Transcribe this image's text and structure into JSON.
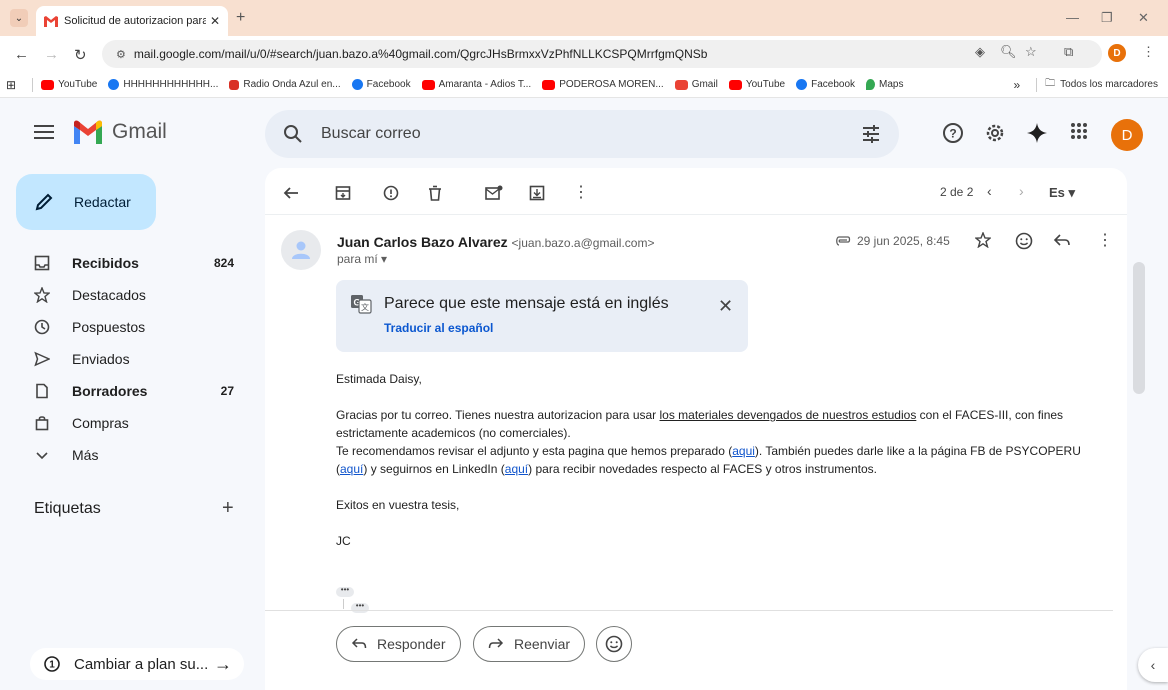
{
  "browser": {
    "tab_title": "Solicitud de autorizacion para e",
    "url": "mail.google.com/mail/u/0/#search/juan.bazo.a%40gmail.com/QgrcJHsBrmxxVzPhfNLLKCSPQMrrfgmQNSb",
    "profile_initial": "D",
    "bookmarks": [
      {
        "label": "YouTube",
        "color": "#ff0000"
      },
      {
        "label": "HHHHHHHHHHHH...",
        "color": "#1877f2"
      },
      {
        "label": "Radio Onda Azul en...",
        "color": "#d93025"
      },
      {
        "label": "Facebook",
        "color": "#1877f2"
      },
      {
        "label": "Amaranta - Adios T...",
        "color": "#ff0000"
      },
      {
        "label": "PODEROSA MOREN...",
        "color": "#ff0000"
      },
      {
        "label": "Gmail",
        "color": "#ea4335"
      },
      {
        "label": "YouTube",
        "color": "#ff0000"
      },
      {
        "label": "Facebook",
        "color": "#1877f2"
      },
      {
        "label": "Maps",
        "color": "#34a853"
      }
    ],
    "more_bookmarks": "»",
    "all_bookmarks": "Todos los marcadores"
  },
  "gmail": {
    "logo_text": "Gmail",
    "search_placeholder": "Buscar correo",
    "avatar_initial": "D",
    "compose_label": "Redactar",
    "nav": [
      {
        "label": "Recibidos",
        "count": "824",
        "bold": true
      },
      {
        "label": "Destacados",
        "count": "",
        "bold": false
      },
      {
        "label": "Pospuestos",
        "count": "",
        "bold": false
      },
      {
        "label": "Enviados",
        "count": "",
        "bold": false
      },
      {
        "label": "Borradores",
        "count": "27",
        "bold": true
      },
      {
        "label": "Compras",
        "count": "",
        "bold": false
      },
      {
        "label": "Más",
        "count": "",
        "bold": false
      }
    ],
    "labels_header": "Etiquetas",
    "upgrade_label": "Cambiar a plan su...",
    "pager": "2 de 2",
    "lang_badge": "Es"
  },
  "message": {
    "sender_name": "Juan Carlos Bazo Alvarez",
    "sender_email": "<juan.bazo.a@gmail.com>",
    "to_me": "para mí",
    "date": "29 jun 2025, 8:45",
    "translate_text": "Parece que este mensaje está en inglés",
    "translate_link": "Traducir al español",
    "greeting": "Estimada Daisy,",
    "p1_a": "Gracias por tu correo. Tienes nuestra autorizacion para usar ",
    "p1_link": "los materiales devengados de nuestros estudios",
    "p1_b": " con el FACES-III, con fines estrictamente academicos (no comerciales).",
    "p2_a": "Te recomendamos revisar el adjunto y esta pagina que hemos preparado (",
    "p2_link1": "aqui",
    "p2_b": "). También puedes darle like a la página FB de PSYCOPERU (",
    "p2_link2": "aquí",
    "p2_c": ") y seguirnos en LinkedIn (",
    "p2_link3": "aquí",
    "p2_d": ") para recibir novedades respecto al FACES y otros instrumentos.",
    "closing": "Exitos en vuestra tesis,",
    "signature": "JC",
    "reply_label": "Responder",
    "forward_label": "Reenviar"
  }
}
